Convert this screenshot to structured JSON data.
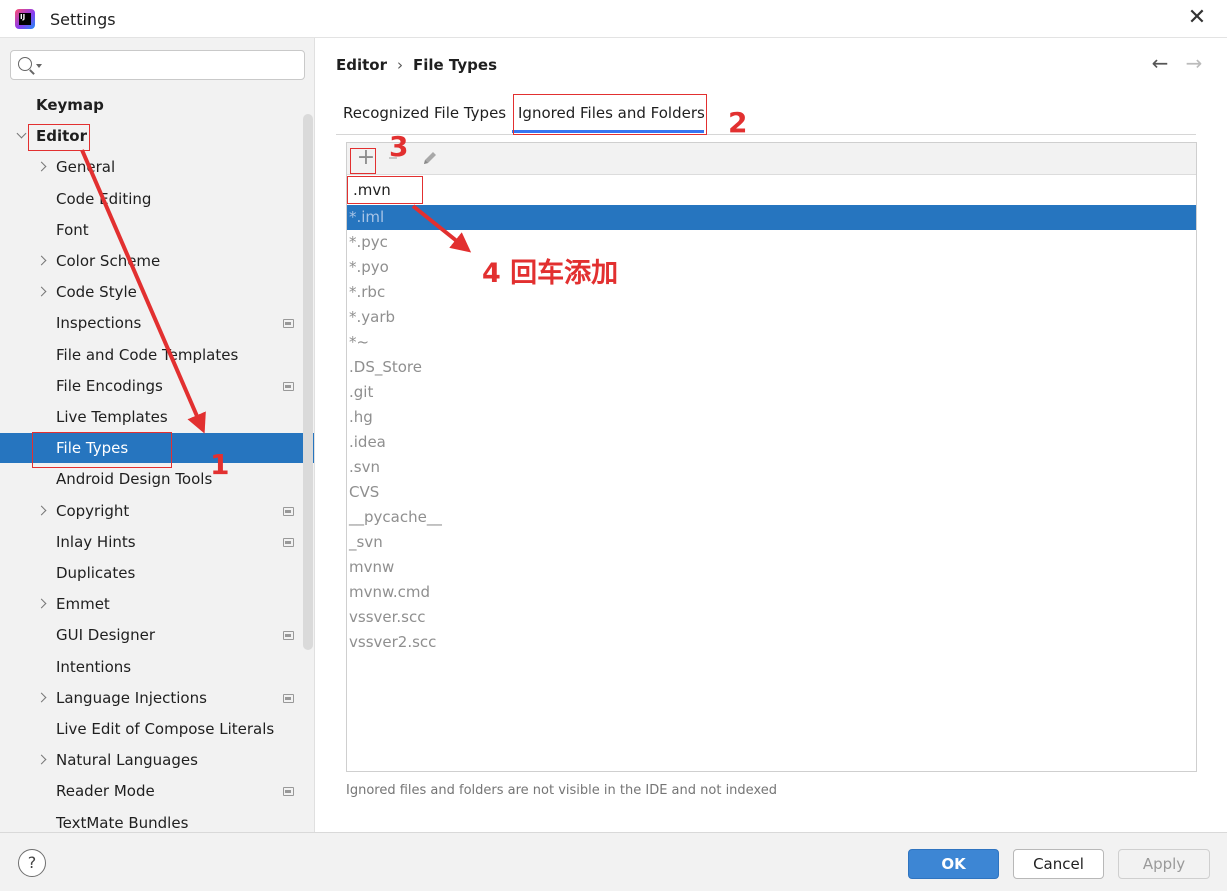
{
  "window": {
    "title": "Settings",
    "app_icon_text": "IJ"
  },
  "search": {
    "value": "",
    "placeholder": ""
  },
  "sidebar": {
    "items": [
      {
        "label": "Keymap",
        "level": 0,
        "expandable": false,
        "expanded": false,
        "project_icon": false
      },
      {
        "label": "Editor",
        "level": 0,
        "expandable": true,
        "expanded": true,
        "project_icon": false
      },
      {
        "label": "General",
        "level": 1,
        "expandable": true,
        "project_icon": false
      },
      {
        "label": "Code Editing",
        "level": 1,
        "expandable": false,
        "project_icon": false
      },
      {
        "label": "Font",
        "level": 1,
        "expandable": false,
        "project_icon": false
      },
      {
        "label": "Color Scheme",
        "level": 1,
        "expandable": true,
        "project_icon": false
      },
      {
        "label": "Code Style",
        "level": 1,
        "expandable": true,
        "project_icon": false
      },
      {
        "label": "Inspections",
        "level": 1,
        "expandable": false,
        "project_icon": true
      },
      {
        "label": "File and Code Templates",
        "level": 1,
        "expandable": false,
        "project_icon": false
      },
      {
        "label": "File Encodings",
        "level": 1,
        "expandable": false,
        "project_icon": true
      },
      {
        "label": "Live Templates",
        "level": 1,
        "expandable": false,
        "project_icon": false
      },
      {
        "label": "File Types",
        "level": 1,
        "expandable": false,
        "project_icon": false,
        "selected": true
      },
      {
        "label": "Android Design Tools",
        "level": 1,
        "expandable": false,
        "project_icon": false
      },
      {
        "label": "Copyright",
        "level": 1,
        "expandable": true,
        "project_icon": true
      },
      {
        "label": "Inlay Hints",
        "level": 1,
        "expandable": false,
        "project_icon": true
      },
      {
        "label": "Duplicates",
        "level": 1,
        "expandable": false,
        "project_icon": false
      },
      {
        "label": "Emmet",
        "level": 1,
        "expandable": true,
        "project_icon": false
      },
      {
        "label": "GUI Designer",
        "level": 1,
        "expandable": false,
        "project_icon": true
      },
      {
        "label": "Intentions",
        "level": 1,
        "expandable": false,
        "project_icon": false
      },
      {
        "label": "Language Injections",
        "level": 1,
        "expandable": true,
        "project_icon": true
      },
      {
        "label": "Live Edit of Compose Literals",
        "level": 1,
        "expandable": false,
        "project_icon": false
      },
      {
        "label": "Natural Languages",
        "level": 1,
        "expandable": true,
        "project_icon": false
      },
      {
        "label": "Reader Mode",
        "level": 1,
        "expandable": false,
        "project_icon": true
      },
      {
        "label": "TextMate Bundles",
        "level": 1,
        "expandable": false,
        "project_icon": false
      }
    ]
  },
  "main": {
    "breadcrumb": {
      "parent": "Editor",
      "separator": "›",
      "current": "File Types"
    },
    "nav": {
      "back": "←",
      "forward": "→"
    },
    "tabs": [
      {
        "label": "Recognized File Types",
        "active": false
      },
      {
        "label": "Ignored Files and Folders",
        "active": true
      }
    ],
    "toolbar": {
      "add": "+",
      "remove": "−",
      "edit": "pencil"
    },
    "edit_value": ".mvn",
    "ignored": [
      "*.iml",
      "*.pyc",
      "*.pyo",
      "*.rbc",
      "*.yarb",
      "*~",
      ".DS_Store",
      ".git",
      ".hg",
      ".idea",
      ".svn",
      "CVS",
      "__pycache__",
      "_svn",
      "mvnw",
      "mvnw.cmd",
      "vssver.scc",
      "vssver2.scc"
    ],
    "selected_index": 0,
    "note": "Ignored files and folders are not visible in the IDE and not indexed"
  },
  "footer": {
    "help": "?",
    "ok": "OK",
    "cancel": "Cancel",
    "apply": "Apply"
  },
  "annotations": {
    "step1": "1",
    "step2": "2",
    "step3": "3",
    "step4": "4 回车添加",
    "color": "#e23030"
  },
  "colors": {
    "selection": "#2675bf",
    "tab_underline": "#3574f0",
    "ok_button": "#3d86d4"
  }
}
